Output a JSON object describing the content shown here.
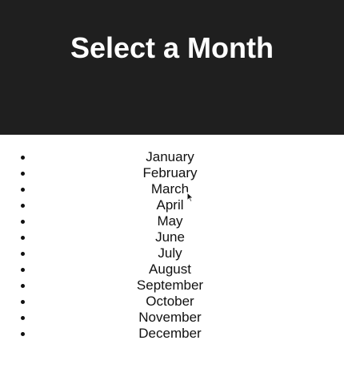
{
  "header": {
    "title": "Select a Month"
  },
  "months": [
    "January",
    "February",
    "March",
    "April",
    "May",
    "June",
    "July",
    "August",
    "September",
    "October",
    "November",
    "December"
  ],
  "colors": {
    "header_bg": "#1f1f1f",
    "title_text": "#ffffff",
    "list_text": "#111111"
  },
  "icons": {
    "pointer": "cursor-arrow-icon"
  }
}
